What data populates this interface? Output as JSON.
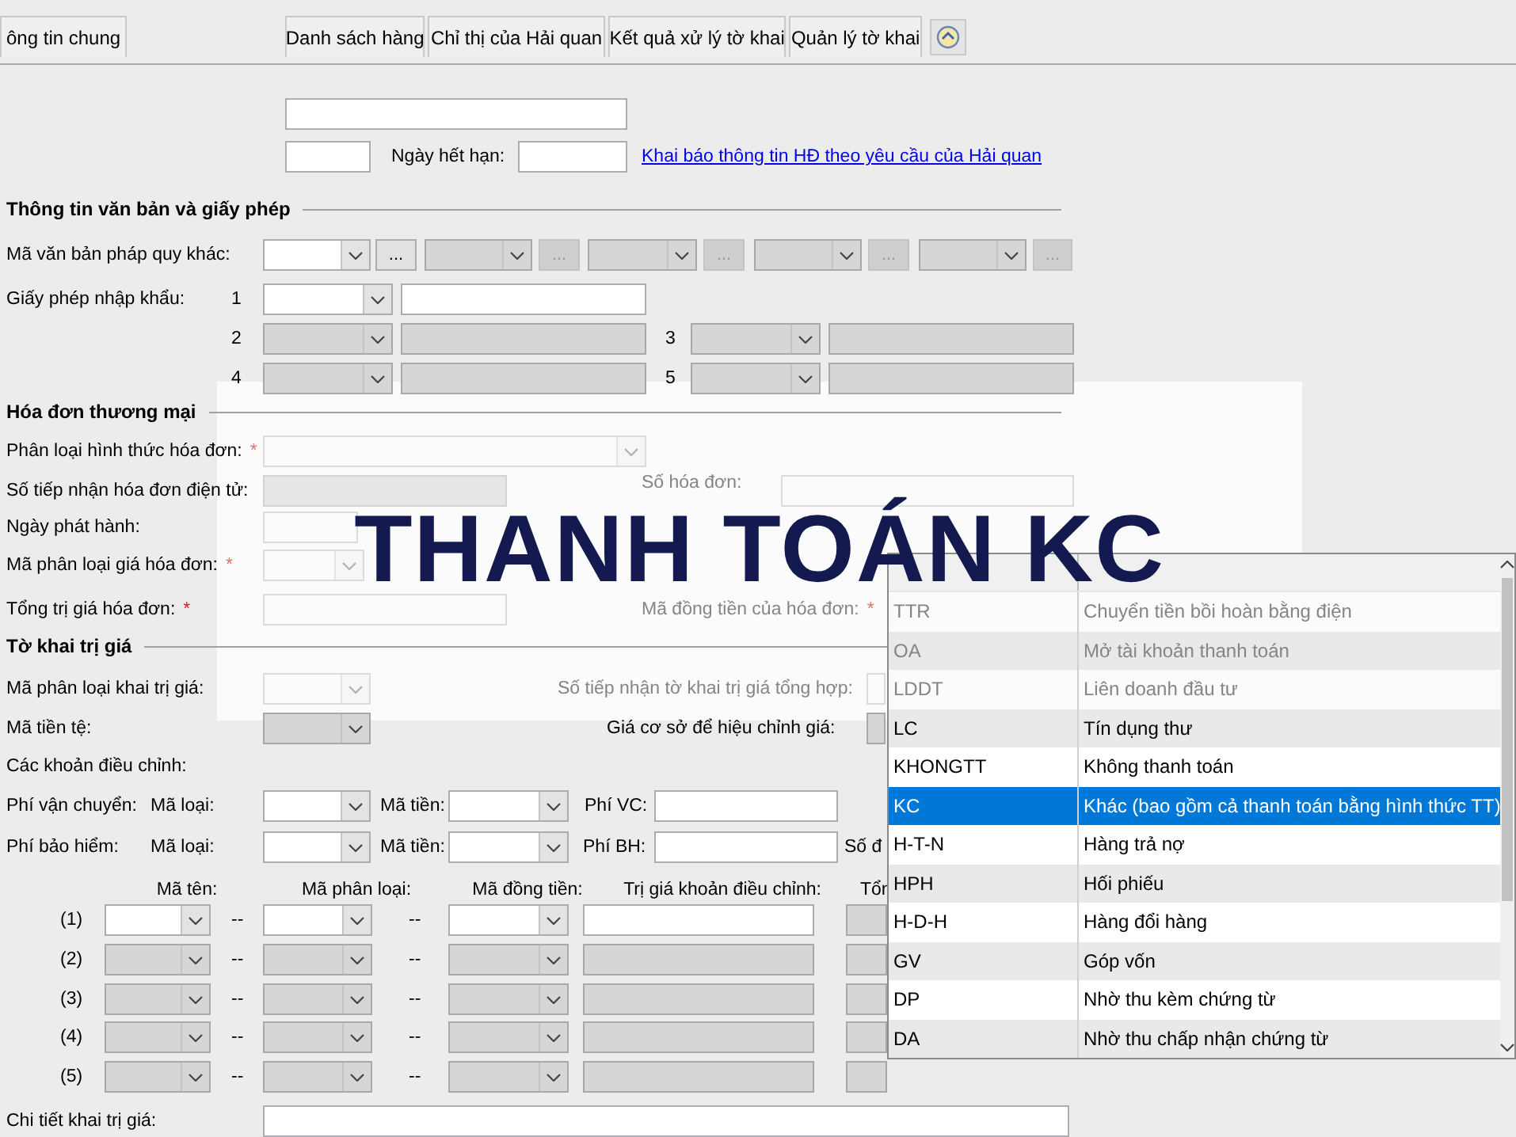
{
  "tabs": [
    {
      "label": "ông tin chung",
      "selected": false
    },
    {
      "label": "Danh sách hàng",
      "selected": false
    },
    {
      "label": "Chỉ thị của Hải quan",
      "selected": false
    },
    {
      "label": "Kết quả xử lý tờ khai",
      "selected": false
    },
    {
      "label": "Quản lý tờ khai",
      "selected": false
    }
  ],
  "form": {
    "rows": [
      {
        "items": [
          {
            "kind": "input",
            "disabled": false
          }
        ]
      },
      {
        "items": [
          {
            "kind": "input",
            "disabled": false
          },
          {
            "kind": "label",
            "text": "Ngày hết hạn:"
          },
          {
            "kind": "input",
            "disabled": false
          },
          {
            "kind": "link",
            "text": "Khai báo thông tin HĐ theo yêu cầu của Hải quan"
          }
        ]
      },
      {
        "heading": "Thông tin văn bản và giấy phép"
      },
      {
        "items": [
          {
            "kind": "label",
            "text": "Mã văn bản pháp quy khác:"
          },
          {
            "kind": "combo",
            "disabled": false
          },
          {
            "kind": "button",
            "text": "...",
            "disabled": false
          },
          {
            "kind": "combo",
            "disabled": true
          },
          {
            "kind": "button",
            "text": "...",
            "disabled": true
          },
          {
            "kind": "combo",
            "disabled": true
          },
          {
            "kind": "button",
            "text": "...",
            "disabled": true
          },
          {
            "kind": "combo",
            "disabled": true
          },
          {
            "kind": "button",
            "text": "...",
            "disabled": true
          },
          {
            "kind": "combo",
            "disabled": true
          },
          {
            "kind": "button",
            "text": "...",
            "disabled": true
          }
        ]
      },
      {
        "items": [
          {
            "kind": "label",
            "text": "Giấy phép nhập khẩu:"
          },
          {
            "kind": "number",
            "text": "1"
          },
          {
            "kind": "combo",
            "disabled": false
          },
          {
            "kind": "input",
            "disabled": false
          }
        ]
      },
      {
        "items": [
          {
            "kind": "number",
            "text": "2"
          },
          {
            "kind": "combo",
            "disabled": true
          },
          {
            "kind": "input",
            "disabled": true
          },
          {
            "kind": "number",
            "text": "3"
          },
          {
            "kind": "combo",
            "disabled": true
          },
          {
            "kind": "input",
            "disabled": true
          }
        ]
      },
      {
        "items": [
          {
            "kind": "number",
            "text": "4"
          },
          {
            "kind": "combo",
            "disabled": true
          },
          {
            "kind": "input",
            "disabled": true
          },
          {
            "kind": "number",
            "text": "5"
          },
          {
            "kind": "combo",
            "disabled": true
          },
          {
            "kind": "input",
            "disabled": true
          }
        ]
      },
      {
        "heading": "Hóa đơn thương mại"
      },
      {
        "items": [
          {
            "kind": "label",
            "text": "Phân loại hình thức hóa đơn:",
            "asterisk": "*"
          },
          {
            "kind": "combo",
            "disabled": false
          }
        ]
      },
      {
        "items": [
          {
            "kind": "label",
            "text": "Số tiếp nhận hóa đơn điện tử:"
          },
          {
            "kind": "input",
            "disabled": true
          },
          {
            "kind": "label",
            "text": "Số hóa đơn:"
          },
          {
            "kind": "input",
            "disabled": false
          }
        ]
      },
      {
        "items": [
          {
            "kind": "label",
            "text": "Ngày phát hành:"
          },
          {
            "kind": "input",
            "disabled": false
          }
        ]
      },
      {
        "items": [
          {
            "kind": "label",
            "text": "Mã phân loại giá hóa đơn:",
            "asterisk": "*"
          },
          {
            "kind": "combo",
            "disabled": false
          }
        ]
      },
      {
        "items": [
          {
            "kind": "label",
            "text": "Tổng trị giá hóa đơn:",
            "asterisk": "*"
          },
          {
            "kind": "input",
            "disabled": false
          },
          {
            "kind": "label",
            "text": "Mã đồng tiền của hóa đơn:",
            "asterisk": "*"
          }
        ]
      },
      {
        "heading": "Tờ khai trị giá"
      },
      {
        "items": [
          {
            "kind": "label",
            "text": "Mã phân loại khai trị giá:"
          },
          {
            "kind": "combo",
            "disabled": false
          },
          {
            "kind": "label",
            "text": "Số tiếp nhận tờ khai trị giá tổng hợp:"
          },
          {
            "kind": "input",
            "disabled": false
          }
        ]
      },
      {
        "items": [
          {
            "kind": "label",
            "text": "Mã tiền tệ:"
          },
          {
            "kind": "combo",
            "disabled": true
          },
          {
            "kind": "label",
            "text": "Giá cơ sở để hiệu chỉnh giá:"
          },
          {
            "kind": "input",
            "disabled": true
          }
        ]
      },
      {
        "items": [
          {
            "kind": "label",
            "text": "Các khoản điều chỉnh:"
          }
        ]
      },
      {
        "items": [
          {
            "kind": "label",
            "text": "Phí vận chuyển:"
          },
          {
            "kind": "label",
            "text": "Mã loại:"
          },
          {
            "kind": "combo",
            "disabled": false
          },
          {
            "kind": "label",
            "text": "Mã tiền:"
          },
          {
            "kind": "combo",
            "disabled": false
          },
          {
            "kind": "label",
            "text": "Phí VC:"
          },
          {
            "kind": "input",
            "disabled": false
          }
        ]
      },
      {
        "items": [
          {
            "kind": "label",
            "text": "Phí bảo hiểm:"
          },
          {
            "kind": "label",
            "text": "Mã loại:"
          },
          {
            "kind": "combo",
            "disabled": false
          },
          {
            "kind": "label",
            "text": "Mã tiền:"
          },
          {
            "kind": "combo",
            "disabled": false
          },
          {
            "kind": "label",
            "text": "Phí BH:"
          },
          {
            "kind": "input",
            "disabled": false
          },
          {
            "kind": "label",
            "text": "Số đ"
          }
        ]
      },
      {
        "items": [
          {
            "kind": "header",
            "text": "Mã tên:"
          },
          {
            "kind": "header",
            "text": "Mã phân loại:"
          },
          {
            "kind": "header",
            "text": "Mã đồng tiền:"
          },
          {
            "kind": "header",
            "text": "Trị giá khoản điều chỉnh:"
          },
          {
            "kind": "header",
            "text": "Tổn"
          }
        ]
      },
      {
        "items": [
          {
            "kind": "number",
            "text": "(1)"
          },
          {
            "kind": "combo",
            "disabled": false
          },
          {
            "kind": "dash",
            "text": "--"
          },
          {
            "kind": "combo",
            "disabled": false
          },
          {
            "kind": "dash",
            "text": "--"
          },
          {
            "kind": "combo",
            "disabled": false
          },
          {
            "kind": "input",
            "disabled": false
          },
          {
            "kind": "input",
            "disabled": true
          }
        ]
      },
      {
        "items": [
          {
            "kind": "number",
            "text": "(2)"
          },
          {
            "kind": "combo",
            "disabled": true
          },
          {
            "kind": "dash",
            "text": "--"
          },
          {
            "kind": "combo",
            "disabled": true
          },
          {
            "kind": "dash",
            "text": "--"
          },
          {
            "kind": "combo",
            "disabled": true
          },
          {
            "kind": "input",
            "disabled": true
          },
          {
            "kind": "input",
            "disabled": true
          }
        ]
      },
      {
        "items": [
          {
            "kind": "number",
            "text": "(3)"
          },
          {
            "kind": "combo",
            "disabled": true
          },
          {
            "kind": "dash",
            "text": "--"
          },
          {
            "kind": "combo",
            "disabled": true
          },
          {
            "kind": "dash",
            "text": "--"
          },
          {
            "kind": "combo",
            "disabled": true
          },
          {
            "kind": "input",
            "disabled": true
          },
          {
            "kind": "input",
            "disabled": true
          }
        ]
      },
      {
        "items": [
          {
            "kind": "number",
            "text": "(4)"
          },
          {
            "kind": "combo",
            "disabled": true
          },
          {
            "kind": "dash",
            "text": "--"
          },
          {
            "kind": "combo",
            "disabled": true
          },
          {
            "kind": "dash",
            "text": "--"
          },
          {
            "kind": "combo",
            "disabled": true
          },
          {
            "kind": "input",
            "disabled": true
          },
          {
            "kind": "input",
            "disabled": true
          }
        ]
      },
      {
        "items": [
          {
            "kind": "number",
            "text": "(5)"
          },
          {
            "kind": "combo",
            "disabled": true
          },
          {
            "kind": "dash",
            "text": "--"
          },
          {
            "kind": "combo",
            "disabled": true
          },
          {
            "kind": "dash",
            "text": "--"
          },
          {
            "kind": "combo",
            "disabled": true
          },
          {
            "kind": "input",
            "disabled": true
          },
          {
            "kind": "input",
            "disabled": true
          }
        ]
      },
      {
        "items": [
          {
            "kind": "label",
            "text": "Chi tiết khai trị giá:"
          },
          {
            "kind": "input",
            "disabled": false
          }
        ]
      }
    ]
  },
  "payment_list": {
    "rows": [
      {
        "code": "TTR",
        "name": "Chuyển tiền bồi hoàn bằng điện",
        "selected": false
      },
      {
        "code": "OA",
        "name": "Mở tài khoản thanh toán",
        "selected": false
      },
      {
        "code": "LDDT",
        "name": "Liên doanh đầu tư",
        "selected": false
      },
      {
        "code": "LC",
        "name": "Tín dụng thư",
        "selected": false
      },
      {
        "code": "KHONGTT",
        "name": "Không thanh toán",
        "selected": false
      },
      {
        "code": "KC",
        "name": "Khác (bao gồm cả thanh toán bằng hình thức TT)",
        "selected": true
      },
      {
        "code": "H-T-N",
        "name": "Hàng trả nợ",
        "selected": false
      },
      {
        "code": "HPH",
        "name": "Hối phiếu",
        "selected": false
      },
      {
        "code": "H-D-H",
        "name": "Hàng đổi hàng",
        "selected": false
      },
      {
        "code": "GV",
        "name": "Góp vốn",
        "selected": false
      },
      {
        "code": "DP",
        "name": "Nhờ thu kèm chứng từ",
        "selected": false
      },
      {
        "code": "DA",
        "name": "Nhờ thu chấp nhận chứng từ",
        "selected": false
      }
    ]
  },
  "banner": {
    "title": "THANH TOÁN KC"
  }
}
